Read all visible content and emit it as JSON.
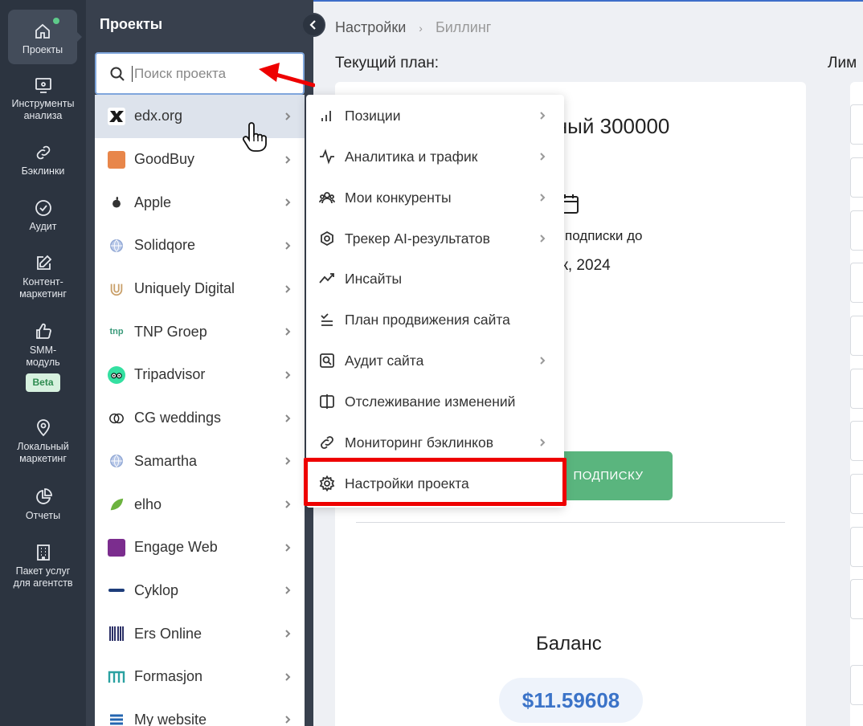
{
  "rail": {
    "items": [
      {
        "label": "Проекты",
        "icon": "home-icon"
      },
      {
        "label": "Инструменты анализа",
        "icon": "monitor-icon"
      },
      {
        "label": "Бэклинки",
        "icon": "link-icon"
      },
      {
        "label": "Аудит",
        "icon": "check-circle-icon"
      },
      {
        "label": "Контент-маркетинг",
        "icon": "edit-icon"
      },
      {
        "label": "SMM-модуль",
        "icon": "thumbs-up-icon",
        "badge": "Beta"
      },
      {
        "label": "Локальный маркетинг",
        "icon": "pin-icon"
      },
      {
        "label": "Отчеты",
        "icon": "pie-chart-icon"
      },
      {
        "label": "Пакет услуг для агентств",
        "icon": "building-icon"
      }
    ]
  },
  "projects": {
    "title": "Проекты",
    "search_placeholder": "Поиск проекта",
    "items": [
      {
        "name": "edx.org",
        "logo_color": "#1a1a1a"
      },
      {
        "name": "GoodBuy",
        "logo_color": "#e8864a"
      },
      {
        "name": "Apple",
        "logo_color": "#333333"
      },
      {
        "name": "Solidqore",
        "logo_color": "#8fa6d4"
      },
      {
        "name": "Uniquely Digital",
        "logo_color": "#c9a06a"
      },
      {
        "name": "TNP Groep",
        "logo_color": "#3a9a7a"
      },
      {
        "name": "Tripadvisor",
        "logo_color": "#34e0a1"
      },
      {
        "name": "CG weddings",
        "logo_color": "#222222"
      },
      {
        "name": "Samartha",
        "logo_color": "#8fa6d4"
      },
      {
        "name": "elho",
        "logo_color": "#6cb33f"
      },
      {
        "name": "Engage Web",
        "logo_color": "#7b2d8e"
      },
      {
        "name": "Cyklop",
        "logo_color": "#1d3d7a"
      },
      {
        "name": "Ers Online",
        "logo_color": "#2b2f66"
      },
      {
        "name": "Formasjon",
        "logo_color": "#2aa1a1"
      },
      {
        "name": "My website",
        "logo_color": "#2466b0"
      }
    ]
  },
  "menu": {
    "items": [
      {
        "label": "Позиции",
        "icon": "bar-chart-icon",
        "has_sub": true
      },
      {
        "label": "Аналитика и трафик",
        "icon": "activity-icon",
        "has_sub": true
      },
      {
        "label": "Мои конкуренты",
        "icon": "users-icon",
        "has_sub": true
      },
      {
        "label": "Трекер AI-результатов",
        "icon": "ai-tracker-icon",
        "has_sub": true
      },
      {
        "label": "Инсайты",
        "icon": "trend-icon",
        "has_sub": false
      },
      {
        "label": "План продвижения сайта",
        "icon": "checklist-icon",
        "has_sub": false
      },
      {
        "label": "Аудит сайта",
        "icon": "audit-icon",
        "has_sub": true
      },
      {
        "label": "Отслеживание изменений",
        "icon": "compare-icon",
        "has_sub": false
      },
      {
        "label": "Мониторинг бэклинков",
        "icon": "link-icon",
        "has_sub": true
      },
      {
        "label": "Настройки проекта",
        "icon": "gear-icon",
        "has_sub": false
      }
    ]
  },
  "breadcrumb": {
    "first": "Настройки",
    "second": "Биллинг"
  },
  "main": {
    "plan_heading": "Текущий план:",
    "limits_heading": "Лим",
    "plan_name": "вный 300000",
    "subscription_until": "подписки до",
    "subscription_date": "ек, 2024",
    "renew_label": "ПОДПИСКУ",
    "balance_label": "Баланс",
    "balance_value": "$11.59608"
  },
  "colors": {
    "accent": "#3b73c8",
    "green": "#5ab57e",
    "highlight": "#e00000"
  }
}
